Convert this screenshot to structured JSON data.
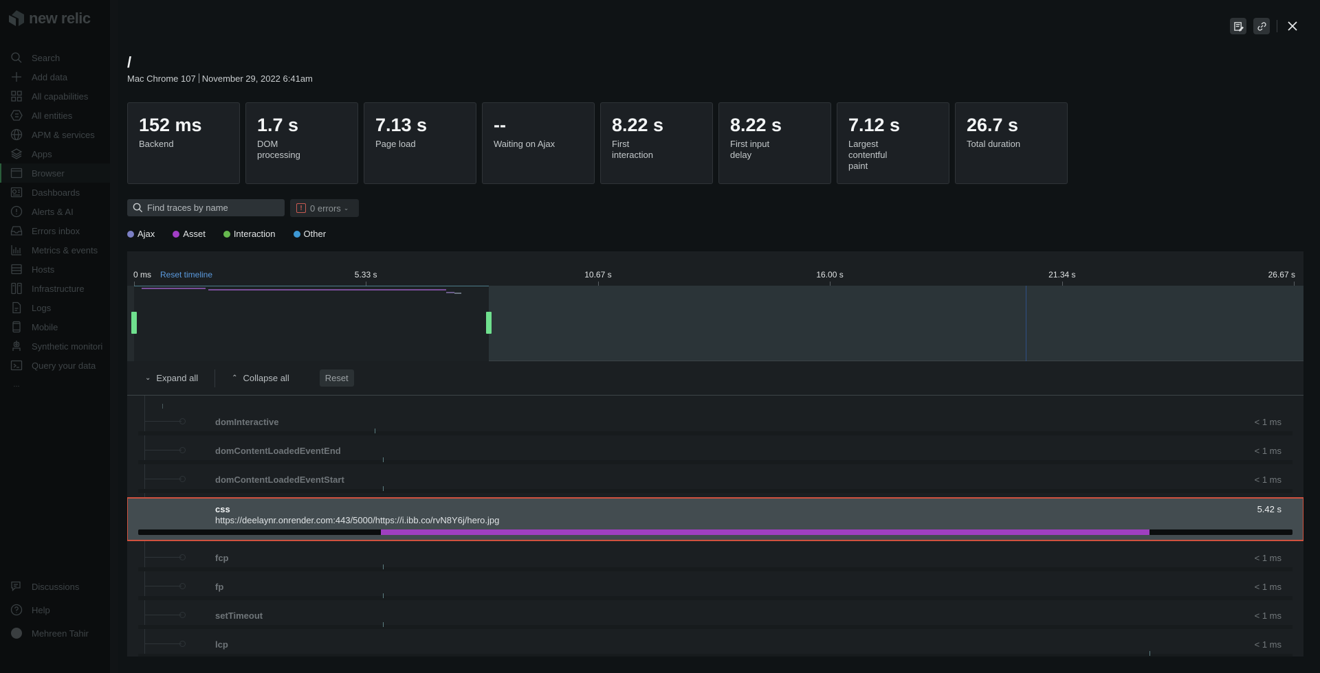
{
  "sidebar": {
    "logo_text": "new relic",
    "items": [
      {
        "label": "Search",
        "icon": "search-icon"
      },
      {
        "label": "Add data",
        "icon": "plus-icon"
      },
      {
        "label": "All capabilities",
        "icon": "grid-icon"
      },
      {
        "label": "All entities",
        "icon": "hexagon-list-icon"
      },
      {
        "label": "APM & services",
        "icon": "globe-icon"
      },
      {
        "label": "Apps",
        "icon": "layers-icon"
      },
      {
        "label": "Browser",
        "icon": "browser-window-icon",
        "active": true
      },
      {
        "label": "Dashboards",
        "icon": "dashboard-icon"
      },
      {
        "label": "Alerts & AI",
        "icon": "alert-circle-icon"
      },
      {
        "label": "Errors inbox",
        "icon": "inbox-icon"
      },
      {
        "label": "Metrics & events",
        "icon": "bar-chart-icon"
      },
      {
        "label": "Hosts",
        "icon": "server-icon"
      },
      {
        "label": "Infrastructure",
        "icon": "infrastructure-icon"
      },
      {
        "label": "Logs",
        "icon": "document-icon"
      },
      {
        "label": "Mobile",
        "icon": "mobile-icon"
      },
      {
        "label": "Synthetic monitori",
        "icon": "robot-icon"
      },
      {
        "label": "Query your data",
        "icon": "terminal-icon"
      },
      {
        "label": "...",
        "icon": "more-icon"
      }
    ],
    "bottom_items": [
      {
        "label": "Discussions",
        "icon": "chat-icon"
      },
      {
        "label": "Help",
        "icon": "help-icon"
      },
      {
        "label": "Mehreen Tahir",
        "icon": "avatar"
      }
    ]
  },
  "header": {
    "title": "/",
    "device": "Mac Chrome 107",
    "timestamp": "November 29, 2022 6:41am",
    "actions": [
      "notes-icon",
      "link-icon",
      "close-icon"
    ]
  },
  "metrics": [
    {
      "value": "152 ms",
      "label": "Backend"
    },
    {
      "value": "1.7 s",
      "label": "DOM processing"
    },
    {
      "value": "7.13 s",
      "label": "Page load"
    },
    {
      "value": "--",
      "label": "Waiting on Ajax"
    },
    {
      "value": "8.22 s",
      "label": "First interaction"
    },
    {
      "value": "8.22 s",
      "label": "First input delay"
    },
    {
      "value": "7.12 s",
      "label": "Largest contentful paint"
    },
    {
      "value": "26.7 s",
      "label": "Total duration"
    }
  ],
  "filters": {
    "search_placeholder": "Find traces by name",
    "search_value": "",
    "errors_label": "0 errors"
  },
  "legend": [
    {
      "label": "Ajax",
      "color": "#7b7fc4"
    },
    {
      "label": "Asset",
      "color": "#a23ec6"
    },
    {
      "label": "Interaction",
      "color": "#66b84e"
    },
    {
      "label": "Other",
      "color": "#3d98d4"
    }
  ],
  "timeline": {
    "reset_label": "Reset timeline",
    "total_seconds": 26.67,
    "ticks": [
      {
        "label": "0 ms",
        "value": 0
      },
      {
        "label": "5.33 s",
        "value": 5.33
      },
      {
        "label": "10.67 s",
        "value": 10.67
      },
      {
        "label": "16.00 s",
        "value": 16.0
      },
      {
        "label": "21.34 s",
        "value": 21.34
      },
      {
        "label": "26.67 s",
        "value": 26.67
      }
    ],
    "selection_seconds": [
      0,
      8.15
    ],
    "marker_seconds": 20.5
  },
  "controls": {
    "expand_label": "Expand all",
    "collapse_label": "Collapse all",
    "reset_label": "Reset"
  },
  "traces": [
    {
      "name": "domInteractive",
      "duration": "< 1 ms",
      "start_fraction": 0.205
    },
    {
      "name": "domContentLoadedEventEnd",
      "duration": "< 1 ms",
      "start_fraction": 0.212
    },
    {
      "name": "domContentLoadedEventStart",
      "duration": "< 1 ms",
      "start_fraction": 0.212
    },
    {
      "name": "css",
      "url": "https://deelaynr.onrender.com:443/5000/https://i.ibb.co/rvN8Y6j/hero.jpg",
      "duration": "5.42 s",
      "start_fraction": 0.21,
      "end_fraction": 0.876,
      "selected": true
    },
    {
      "name": "fcp",
      "duration": "< 1 ms",
      "start_fraction": 0.212
    },
    {
      "name": "fp",
      "duration": "< 1 ms",
      "start_fraction": 0.212
    },
    {
      "name": "setTimeout",
      "duration": "< 1 ms",
      "start_fraction": 0.212
    },
    {
      "name": "lcp",
      "duration": "< 1 ms",
      "start_fraction": 0.876
    }
  ]
}
